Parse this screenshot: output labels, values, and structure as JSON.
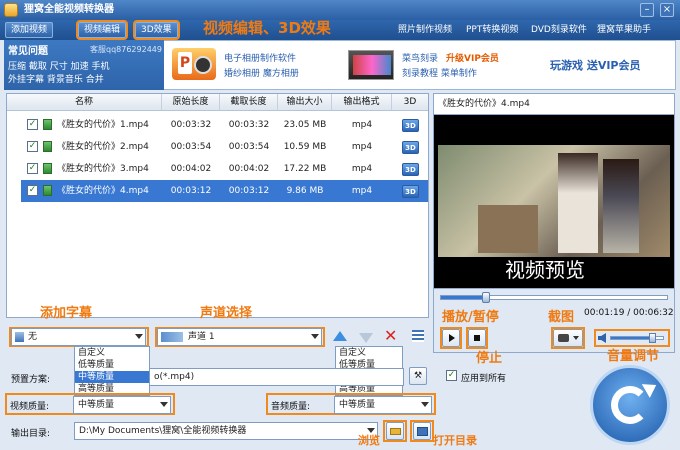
{
  "window": {
    "title": "狸窝全能视频转换器",
    "min": "–",
    "close": "×"
  },
  "toolbar": {
    "add_video": "添加视频",
    "edit_video": "视频编辑",
    "effect_3d": "3D效果",
    "annotation": "视频编辑、3D效果",
    "links": [
      "照片制作视频",
      "PPT转换视频",
      "DVD刻录软件",
      "狸窝苹果助手"
    ]
  },
  "faq": {
    "title": "常见问题",
    "service": "客服qq876292449",
    "line1": "压缩 截取 尺寸 加速 手机",
    "line2": "外挂字幕 背景音乐 合并"
  },
  "banner": {
    "link1": "电子相册制作软件",
    "link2": "婚纱相册 魔方相册",
    "link3": "菜鸟刻录",
    "vip": "升级VIP会员",
    "link4": "刻录教程 菜单制作",
    "game": "玩游戏 送VIP会员"
  },
  "table": {
    "headers": [
      "名称",
      "原始长度",
      "截取长度",
      "输出大小",
      "输出格式",
      "3D"
    ],
    "rows": [
      {
        "check": "✓",
        "name": "《胜女的代价》1.mp4",
        "orig": "00:03:32",
        "cut": "00:03:32",
        "size": "23.05 MB",
        "fmt": "mp4",
        "td": "3D"
      },
      {
        "check": "✓",
        "name": "《胜女的代价》2.mp4",
        "orig": "00:03:54",
        "cut": "00:03:54",
        "size": "10.59 MB",
        "fmt": "mp4",
        "td": "3D"
      },
      {
        "check": "✓",
        "name": "《胜女的代价》3.mp4",
        "orig": "00:04:02",
        "cut": "00:04:02",
        "size": "17.22 MB",
        "fmt": "mp4",
        "td": "3D"
      },
      {
        "check": "✓",
        "name": "《胜女的代价》4.mp4",
        "orig": "00:03:12",
        "cut": "00:03:12",
        "size": "9.86 MB",
        "fmt": "mp4",
        "td": "3D"
      }
    ]
  },
  "preview": {
    "title": "《胜女的代价》4.mp4",
    "overlay": "视频预览",
    "time": "00:01:19 / 00:06:32",
    "progress": 0.2
  },
  "annotations": {
    "subtitle": "添加字幕",
    "audio": "声道选择",
    "play": "播放/暂停",
    "stop": "停止",
    "snapshot": "截图",
    "volume": "音量调节",
    "browse": "浏览",
    "open_dir": "打开目录"
  },
  "subtitle_combo": "无",
  "audio_combo": "声道 1",
  "quality_options": [
    "自定义",
    "低等质量",
    "中等质量",
    "高等质量"
  ],
  "preset": {
    "label": "预置方案:",
    "value_tail": "o(*.mp4)"
  },
  "apply_all": "应用到所有",
  "video_quality": {
    "label": "视频质量:",
    "value": "中等质量"
  },
  "audio_quality": {
    "label": "音频质量:",
    "value": "中等质量"
  },
  "output": {
    "label": "输出目录:",
    "path": "D:\\My Documents\\狸窝\\全能视频转换器"
  },
  "colors": {
    "accent": "#f08a1c",
    "selection": "#3978d2"
  }
}
